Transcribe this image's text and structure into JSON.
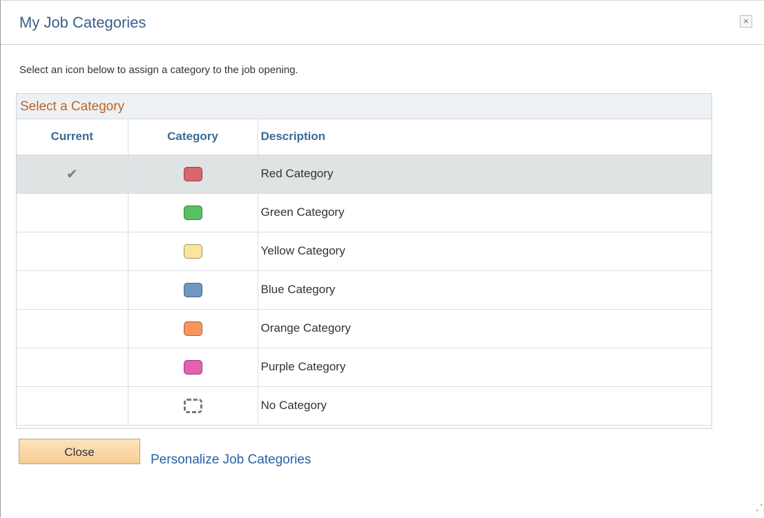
{
  "dialog": {
    "title": "My Job Categories",
    "close_icon": "×",
    "instruction": "Select an icon below to assign a category to the job opening."
  },
  "grid": {
    "title": "Select a Category",
    "columns": [
      "Current",
      "Category",
      "Description"
    ],
    "rows": [
      {
        "current": "✔",
        "color": "#d9666a",
        "description": "Red Category",
        "selected": true
      },
      {
        "current": "",
        "color": "#59c063",
        "description": "Green Category",
        "selected": false
      },
      {
        "current": "",
        "color": "#fbe49b",
        "description": "Yellow Category",
        "selected": false
      },
      {
        "current": "",
        "color": "#6f97c2",
        "description": "Blue Category",
        "selected": false
      },
      {
        "current": "",
        "color": "#f7955f",
        "description": "Orange Category",
        "selected": false
      },
      {
        "current": "",
        "color": "#e660b4",
        "description": "Purple Category",
        "selected": false
      },
      {
        "current": "",
        "color": "",
        "description": "No Category",
        "selected": false
      }
    ]
  },
  "footer": {
    "close_label": "Close",
    "link_label": "Personalize Job Categories"
  },
  "resize_glyph": "⠠⠡"
}
